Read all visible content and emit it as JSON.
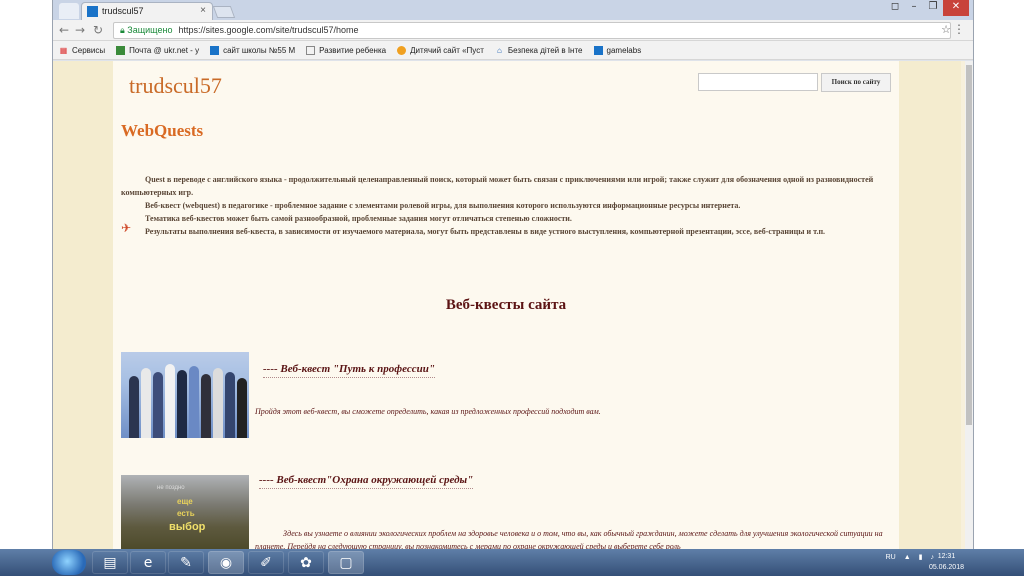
{
  "browser": {
    "tab_title": "trudscul57",
    "address": {
      "secure_label": "Защищено",
      "url": "https://sites.google.com/site/trudscul57/home"
    },
    "bookmarks": [
      {
        "label": "Сервисы",
        "icon": "apps-icon"
      },
      {
        "label": "Почта @ ukr.net - у",
        "icon": "mail-icon"
      },
      {
        "label": "сайт школы №55 М",
        "icon": "school-icon"
      },
      {
        "label": "Развитие ребенка",
        "icon": "page-icon"
      },
      {
        "label": "Дитячий сайт «Пуст",
        "icon": "elephant-icon"
      },
      {
        "label": "Безпека дітей в Інте",
        "icon": "house-icon"
      },
      {
        "label": "gamelabs",
        "icon": "school-icon"
      }
    ]
  },
  "site": {
    "title": "trudscul57",
    "search_button": "Поиск по сайту",
    "heading": "WebQuests",
    "intro": [
      "Quest в переводе с английского языка - продолжительный целенаправленный поиск, который может быть связан с приключениями или игрой; также служит для обозначения одной из разновидностей компьютерных игр.",
      "Веб-квест (webquest) в педагогике - проблемное задание c элементами ролевой игры, для выполнения которого используются информационные ресурсы интернета.",
      "Тематика веб-квестов может быть самой разнообразной, проблемные задания могут отличаться степенью сложности.",
      "Результаты выполнения веб-квеста, в зависимости от изучаемого материала, могут быть представлены в виде устного выступления, компьютерной презентации, эссе, веб-страницы и т.п."
    ],
    "section_title": "Веб-квесты сайта",
    "quests": [
      {
        "title": "----  Веб-квест \"Путь к профессии\"",
        "description": "Пройдя этот веб-квест, вы сможете определить, какая из предложенных профессий подходит вам."
      },
      {
        "title": "---- Веб-квест\"Охрана окружающей среды\"",
        "description": "Здесь вы узнаете о влиянии экологических проблем на здоровье человека и о том, что вы, как обычный гражданин, можете сделать для улучшения экологической ситуации на планете. Перейдя на следующую страницу, вы познакомитесь с  мерами по охране окружающей среды и выберете себе роль",
        "image_text": {
          "line1": "не поздно",
          "line2": "еще",
          "line3": "есть",
          "line4": "выбор"
        }
      }
    ]
  },
  "taskbar": {
    "lang": "RU",
    "time": "12:31",
    "date": "05.06.2018"
  }
}
